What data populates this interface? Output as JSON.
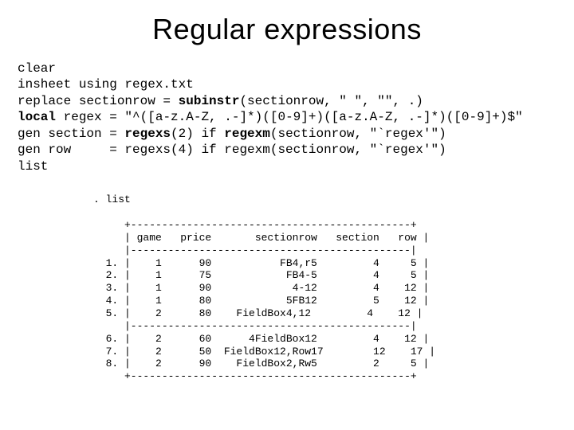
{
  "title": "Regular expressions",
  "code_lines": [
    {
      "plain": "clear"
    },
    {
      "plain": "insheet using regex.txt"
    },
    {
      "plain_before": "replace sectionrow = ",
      "bold": "subinstr",
      "plain_after": "(sectionrow, \" \", \"\", .)"
    },
    {
      "bold_before": "local",
      "plain_after": " regex = \"^([a-z.A-Z, .-]*)([0-9]+)([a-z.A-Z, .-]*)([0-9]+)$\""
    },
    {
      "plain_before": "gen section = ",
      "bold": "regexs",
      "plain_mid": "(2) if ",
      "bold2": "regexm",
      "plain_after": "(sectionrow, \"`regex'\")"
    },
    {
      "plain_before": "gen row     = regexs(4) if regexm(sectionrow, \"`regex'\")"
    },
    {
      "plain": "list"
    }
  ],
  "list_command": ". list",
  "table": {
    "border_top": "+---------------------------------------------+",
    "header": "| game   price       sectionrow   section   row |",
    "divider": "|---------------------------------------------|",
    "rows_a": [
      "  1. |    1      90           FB4,r5         4     5 |",
      "  2. |    1      75            FB4-5         4     5 |",
      "  3. |    1      90             4-12         4    12 |",
      "  4. |    1      80            5FB12         5    12 |",
      "  5. |    2      80    FieldBox4,12         4    12 |"
    ],
    "rows_b": [
      "  6. |    2      60      4FieldBox12         4    12 |",
      "  7. |    2      50  FieldBox12,Row17        12    17 |",
      "  8. |    2      90    FieldBox2,Rw5         2     5 |"
    ],
    "border_bottom": "+---------------------------------------------+"
  }
}
